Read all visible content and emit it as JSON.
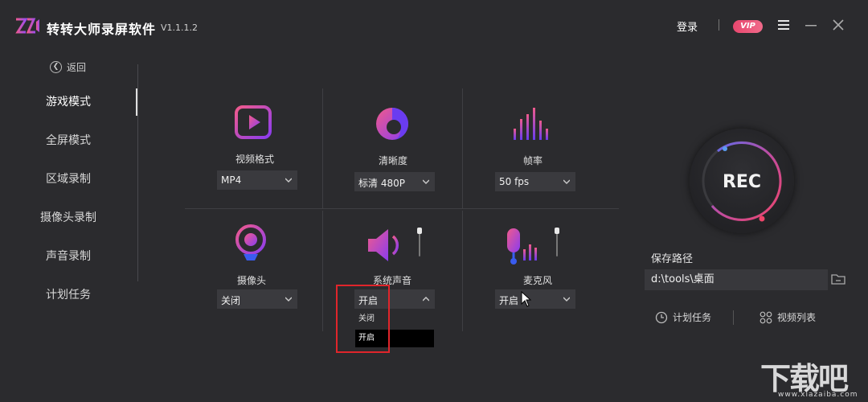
{
  "app": {
    "title": "转转大师录屏软件",
    "version": "V1.1.1.2",
    "login_label": "登录",
    "vip_label": "VIP"
  },
  "colors": {
    "background": "#2b2b2e",
    "accent_pink": "#e8476e",
    "accent_purple": "#8a3cf0",
    "highlight_red": "#e0252b"
  },
  "sidebar": {
    "back_label": "返回",
    "items": [
      {
        "label": "游戏模式",
        "active": true
      },
      {
        "label": "全屏模式"
      },
      {
        "label": "区域录制"
      },
      {
        "label": "摄像头录制"
      },
      {
        "label": "声音录制"
      },
      {
        "label": "计划任务"
      }
    ]
  },
  "settings": {
    "video_format": {
      "label": "视频格式",
      "value": "MP4",
      "icon": "play-icon"
    },
    "clarity": {
      "label": "清晰度",
      "value": "标清 480P",
      "icon": "clarity-icon"
    },
    "frame_rate": {
      "label": "帧率",
      "value": "50 fps",
      "icon": "bars-icon"
    },
    "camera": {
      "label": "摄像头",
      "value": "关闭",
      "icon": "webcam-icon"
    },
    "system_sound": {
      "label": "系统声音",
      "value": "开启",
      "icon": "speaker-icon",
      "dropdown_open": true,
      "options": [
        "关闭",
        "开启"
      ]
    },
    "microphone": {
      "label": "麦克风",
      "value": "开启",
      "icon": "microphone-icon"
    }
  },
  "recorder": {
    "rec_label": "REC",
    "save_path_label": "保存路径",
    "save_path_value": "d:\\tools\\桌面",
    "schedule_label": "计划任务",
    "video_list_label": "视频列表"
  },
  "watermark": {
    "text": "下载吧",
    "url": "www.xiazaiba.com"
  }
}
